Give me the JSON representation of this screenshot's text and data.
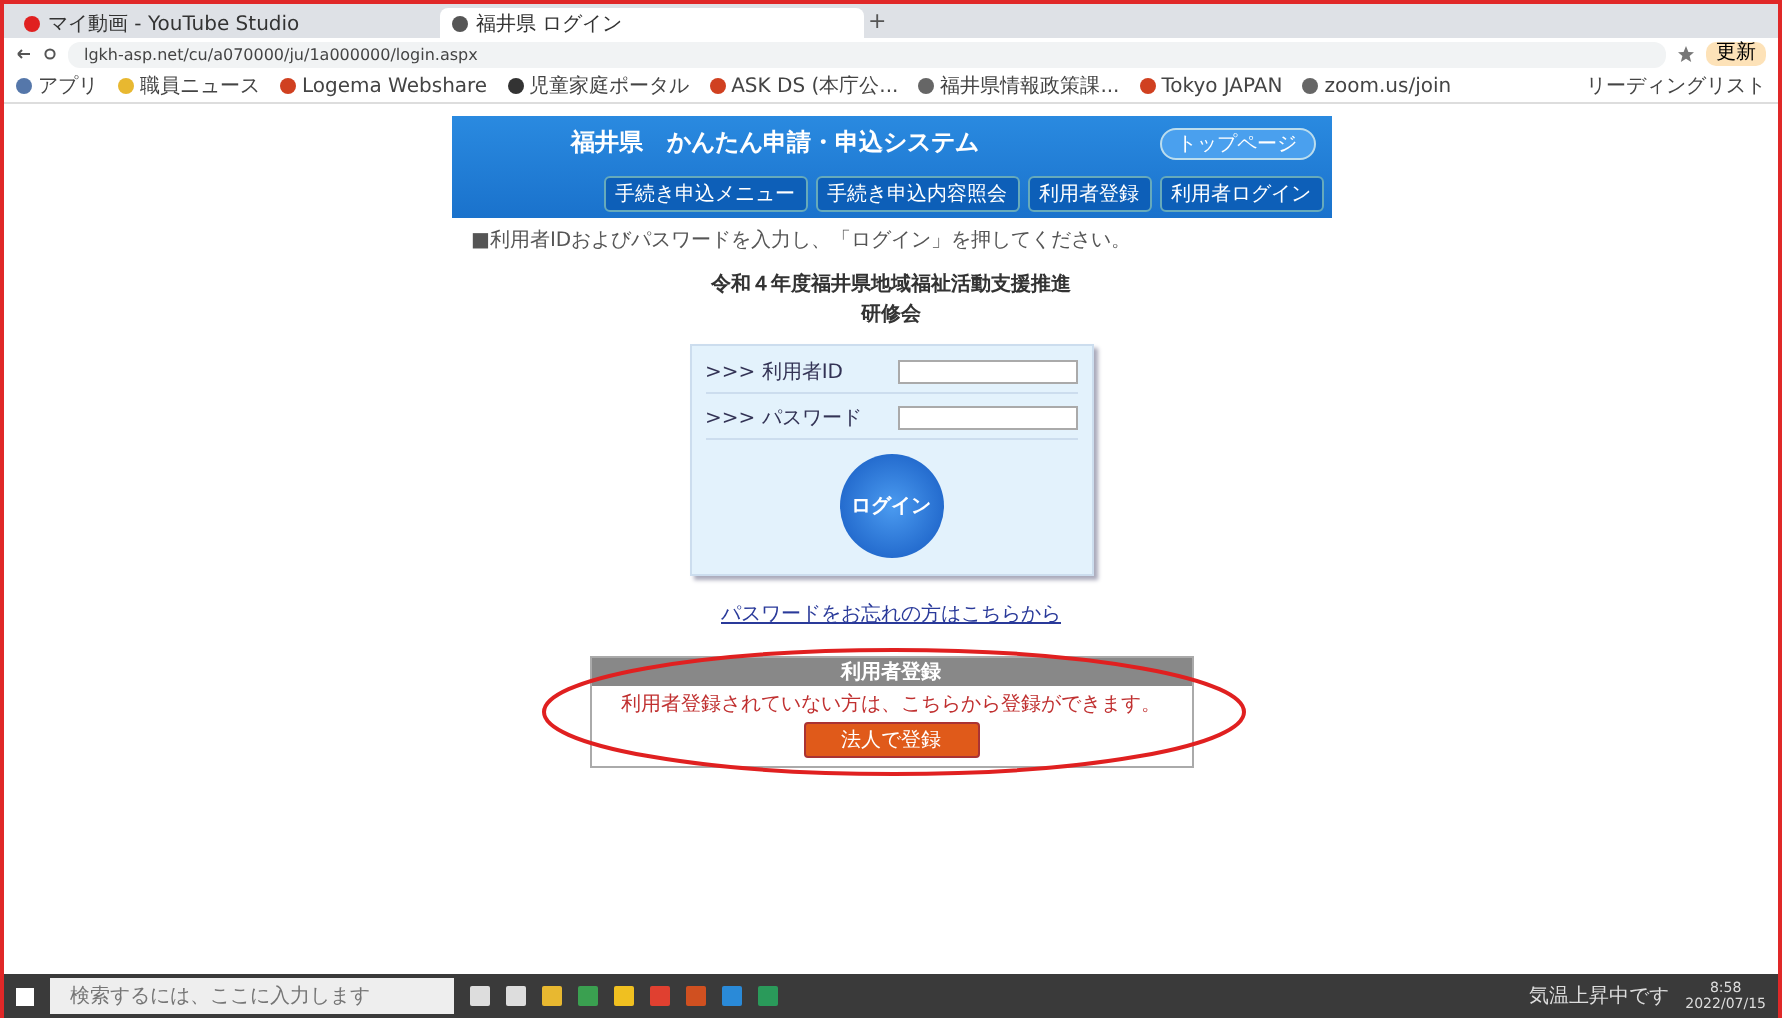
{
  "browser": {
    "tabs": [
      {
        "title": "マイ動画 - YouTube Studio",
        "selected": false
      },
      {
        "title": "福井県 ログイン",
        "selected": true
      }
    ],
    "new_tab": "+",
    "url": "lgkh-asp.net/cu/a070000/ju/1a000000/login.aspx",
    "bookmarks": [
      "アプリ",
      "職員ニュース",
      "Logema Webshare",
      "児童家庭ポータル",
      "ASK DS (本庁公...",
      "福井県情報政策課...",
      "Tokyo JAPAN",
      "zoom.us/join"
    ],
    "reading_list": "リーディングリスト",
    "profile_button": "更新"
  },
  "site": {
    "title": "福井県　かんたん申請・申込システム",
    "top_button": "トップページ",
    "nav": [
      "手続き申込メニュー",
      "手続き申込内容照会",
      "利用者登録",
      "利用者ログイン"
    ],
    "notice": "■利用者IDおよびパスワードを入力し、「ログイン」を押してください。",
    "heading": [
      "令和４年度福井県地域福祉活動支援推進",
      "研修会"
    ],
    "fields": [
      {
        "label": ">>> 利用者ID"
      },
      {
        "label": ">>> パスワード"
      }
    ],
    "login_button": "ログイン",
    "forgot_link": "パスワードをお忘れの方はこちらから",
    "register": {
      "title": "利用者登録",
      "text": "利用者登録されていない方は、こちらから登録ができます。",
      "button": "法人で登録"
    }
  },
  "annotation": {
    "kind": "ellipse",
    "color": "#e02020"
  },
  "taskbar": {
    "search_placeholder": "検索するには、ここに入力します",
    "weather": "気温上昇中です",
    "time": "8:58",
    "date": "2022/07/15"
  }
}
